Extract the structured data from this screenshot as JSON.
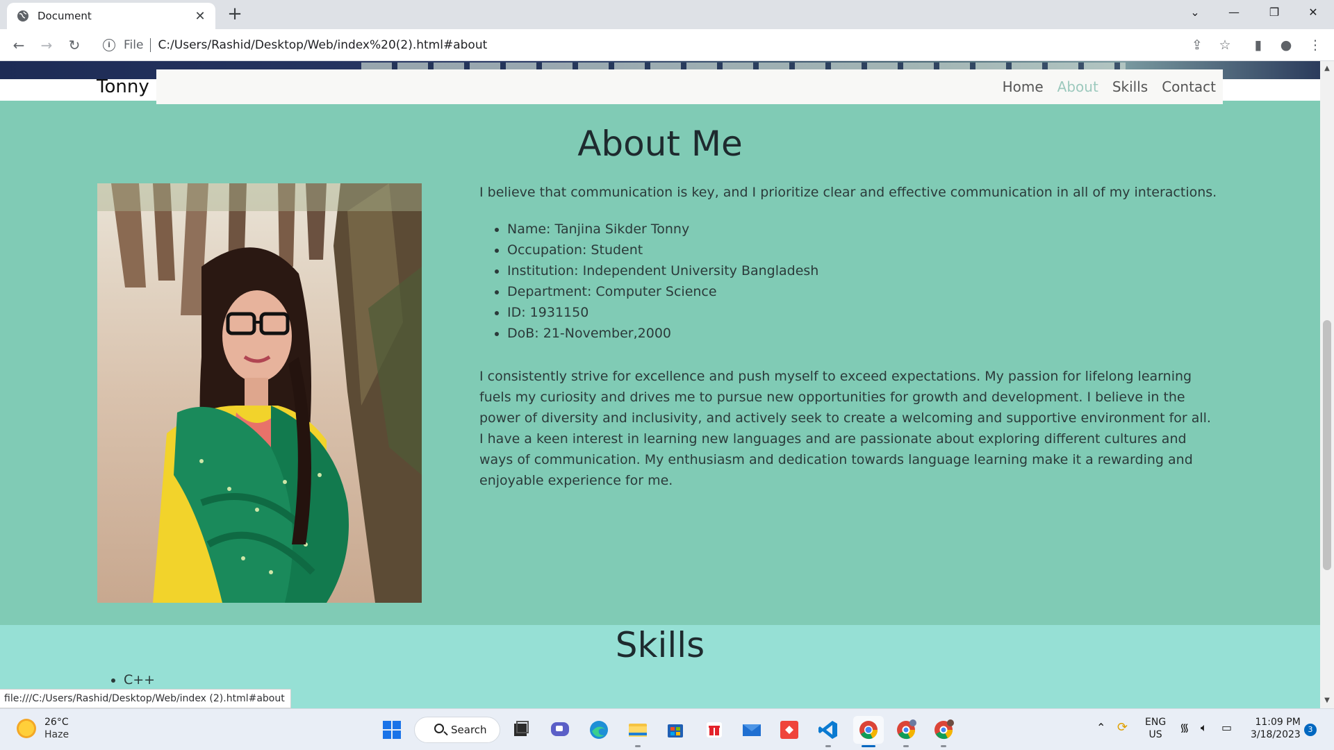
{
  "browser": {
    "tab_title": "Document",
    "url_scheme": "File",
    "url": "C:/Users/Rashid/Desktop/Web/index%20(2).html#about",
    "status_url": "file:///C:/Users/Rashid/Desktop/Web/index (2).html#about"
  },
  "site": {
    "brand": "Tonny",
    "nav": [
      {
        "label": "Home",
        "active": false
      },
      {
        "label": "About",
        "active": true
      },
      {
        "label": "Skills",
        "active": false
      },
      {
        "label": "Contact",
        "active": false
      }
    ],
    "about": {
      "heading": "About Me",
      "intro": "I believe that communication is key, and I prioritize clear and effective communication in all of my interactions.",
      "details": [
        "Name: Tanjina Sikder Tonny",
        "Occupation: Student",
        "Institution: Independent University Bangladesh",
        "Department: Computer Science",
        "ID: 1931150",
        "DoB: 21-November,2000"
      ],
      "paragraph": "I consistently strive for excellence and push myself to exceed expectations. My passion for lifelong learning fuels my curiosity and drives me to pursue new opportunities for growth and development. I believe in the power of diversity and inclusivity, and actively seek to create a welcoming and supportive environment for all. I have a keen interest in learning new languages and are passionate about exploring different cultures and ways of communication. My enthusiasm and dedication towards language learning make it a rewarding and enjoyable experience for me."
    },
    "skills": {
      "heading": "Skills",
      "items": [
        "C++"
      ]
    },
    "colors": {
      "about_bg": "#80cbb5",
      "skills_bg": "#96e0d5",
      "nav_active": "#9cc9bd"
    }
  },
  "taskbar": {
    "weather_temp": "26°C",
    "weather_cond": "Haze",
    "search_label": "Search",
    "lang_top": "ENG",
    "lang_bottom": "US",
    "time": "11:09 PM",
    "date": "3/18/2023",
    "notification_count": "3"
  }
}
